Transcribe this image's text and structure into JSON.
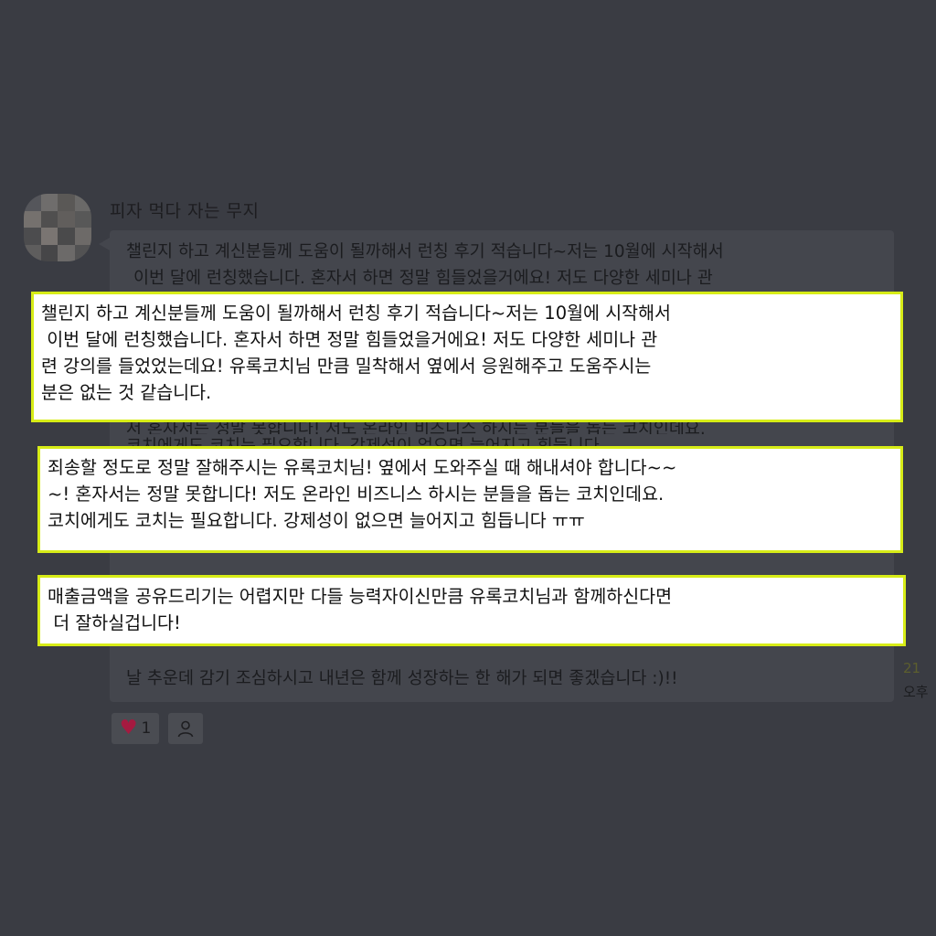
{
  "message": {
    "sender": "피자 먹다 자는 무지",
    "avatar_icon": "pixelated-avatar",
    "background_lines": {
      "line1": "챌린지 하고 계신분들께 도움이 될까해서 런칭 후기 적습니다~저는 10월에 시작해서",
      "line2": "이번 달에 런칭했습니다. 혼자서 하면 정말 힘들었을거에요! 저도 다양한 세미나 관",
      "line3": "저 혼자서는 정말 못합니다! 저도 온라인 비즈니스 하시는 분들을 돕는 코치인데요.",
      "line4": "코치에게도 코치는 필요합니다. 강제성이 없으면 늘어지고 힘듭니다",
      "closing": "날 추운데 감기 조심하시고 내년은 함께 성장하는 한 해가 되면 좋겠습니다 :)!!"
    },
    "highlights": {
      "h1": "챌린지 하고 계신분들께 도움이 될까해서 런칭 후기 적습니다~저는 10월에 시작해서\n 이번 달에 런칭했습니다. 혼자서 하면 정말 힘들었을거에요! 저도 다양한 세미나 관\n련 강의를 들었었는데요! 유록코치님 만큼 밀착해서 옆에서 응원해주고 도움주시는\n분은 없는 것 같습니다.",
      "h2": "죄송할 정도로 정말 잘해주시는 유록코치님! 옆에서 도와주실 때 해내셔야 합니다~~\n~! 혼자서는 정말 못합니다! 저도 온라인 비즈니스 하시는 분들을 돕는 코치인데요.\n코치에게도 코치는 필요합니다. 강제성이 없으면 늘어지고 힘듭니다 ㅠㅠ",
      "h3": "매출금액을 공유드리기는 어렵지만 다들 능력자이신만큼 유록코치님과 함께하신다면\n 더 잘하실겁니다!"
    },
    "time": {
      "day": "21",
      "ampm": "오후"
    }
  },
  "reactions": {
    "like_count": "1",
    "like_icon": "heart-icon",
    "member_icon": "person-icon"
  },
  "colors": {
    "highlight_border": "#d7ec17",
    "heart": "#a51a40"
  }
}
